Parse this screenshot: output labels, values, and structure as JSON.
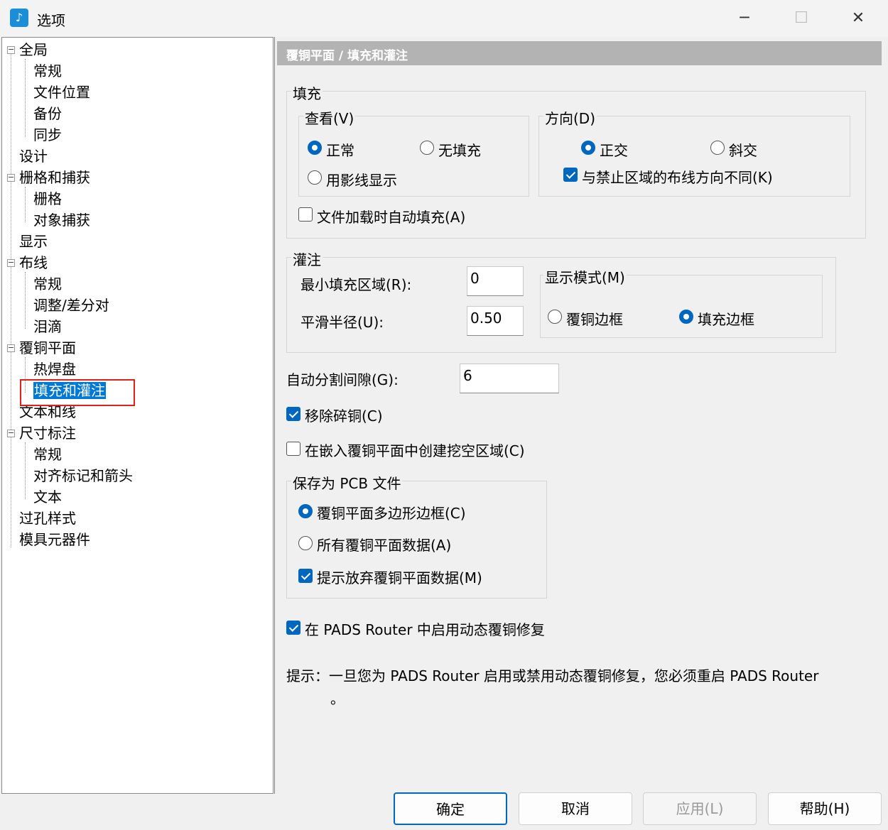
{
  "window": {
    "title": "选项",
    "icon": "pads-app-icon"
  },
  "tree": {
    "items": [
      {
        "label": "全局"
      },
      {
        "label": "常规"
      },
      {
        "label": "文件位置"
      },
      {
        "label": "备份"
      },
      {
        "label": "同步"
      },
      {
        "label": "设计"
      },
      {
        "label": "栅格和捕获"
      },
      {
        "label": "栅格"
      },
      {
        "label": "对象捕获"
      },
      {
        "label": "显示"
      },
      {
        "label": "布线"
      },
      {
        "label": "常规"
      },
      {
        "label": "调整/差分对"
      },
      {
        "label": "泪滴"
      },
      {
        "label": "覆铜平面"
      },
      {
        "label": "热焊盘"
      },
      {
        "label": "填充和灌注"
      },
      {
        "label": "文本和线"
      },
      {
        "label": "尺寸标注"
      },
      {
        "label": "常规"
      },
      {
        "label": "对齐标记和箭头"
      },
      {
        "label": "文本"
      },
      {
        "label": "过孔样式"
      },
      {
        "label": "模具元器件"
      }
    ]
  },
  "panel": {
    "header": "覆铜平面 / 填充和灌注",
    "fill": {
      "label": "填充",
      "view": {
        "label": "查看(V)",
        "normal": "正常",
        "no_fill": "无填充",
        "hatch": "用影线显示",
        "selected": "正常"
      },
      "direction": {
        "label": "方向(D)",
        "orthogonal": "正交",
        "diagonal": "斜交",
        "selected": "正交",
        "differ_label": "与禁止区域的布线方向不同(K)",
        "differ_checked": true
      },
      "auto_fill_label": "文件加载时自动填充(A)",
      "auto_fill_checked": false
    },
    "flood": {
      "label": "灌注",
      "min_area_label": "最小填充区域(R):",
      "min_area_value": "0",
      "smooth_label": "平滑半径(U):",
      "smooth_value": "0.50",
      "display_mode": {
        "label": "显示模式(M)",
        "outline": "覆铜边框",
        "fill_outline": "填充边框",
        "selected": "填充边框"
      }
    },
    "auto_split_label": "自动分割间隙(G):",
    "auto_split_value": "6",
    "remove_slivers_label": "移除碎铜(C)",
    "remove_slivers_checked": true,
    "create_cutout_label": "在嵌入覆铜平面中创建挖空区域(C)",
    "create_cutout_checked": false,
    "save_pcb": {
      "label": "保存为 PCB 文件",
      "outline": "覆铜平面多边形边框(C)",
      "all_data": "所有覆铜平面数据(A)",
      "selected": "覆铜平面多边形边框(C)",
      "prompt_label": "提示放弃覆铜平面数据(M)",
      "prompt_checked": true
    },
    "pads_router_label": "在 PADS Router 中启用动态覆铜修复",
    "pads_router_checked": true,
    "hint_line1": "提示：一旦您为 PADS Router 启用或禁用动态覆铜修复，您必须重启 PADS Router",
    "hint_line2": "。"
  },
  "buttons": {
    "ok": "确定",
    "cancel": "取消",
    "apply": "应用(L)",
    "help": "帮助(H)"
  },
  "colors": {
    "accent": "#0067c0",
    "selection": "#0078d7",
    "highlight_box": "#e0201b",
    "header_bg": "#b3b3b3"
  }
}
